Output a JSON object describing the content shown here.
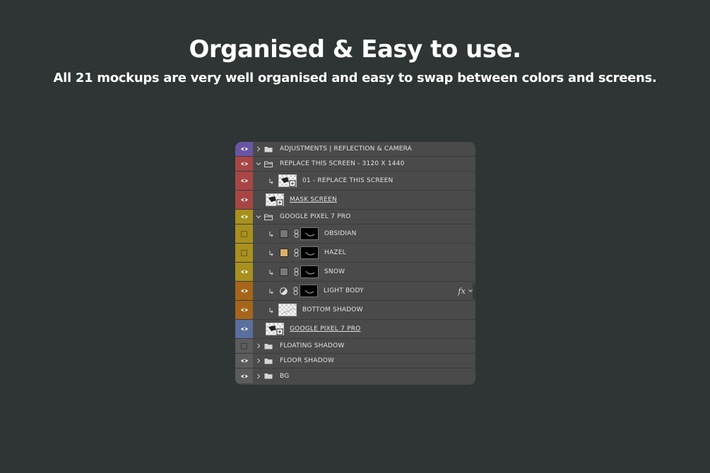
{
  "header": {
    "title": "Organised & Easy to use.",
    "subtitle": "All 21 mockups are very well organised and easy to swap between colors and screens."
  },
  "colors": {
    "background": "#2e3534",
    "panel": "#4a4a4a",
    "violet": "#6a55a5",
    "red": "#a84646",
    "yellow": "#a8901f",
    "orange": "#a5661b",
    "blue": "#5a6f9d",
    "gray": "#5c5c5c"
  },
  "layers": [
    {
      "name": "ADJUSTMENTS | REFLECTION & CAMERA",
      "kind": "group-closed",
      "visible": true,
      "color": "violet"
    },
    {
      "name": "REPLACE THIS SCREEN - 3120 X 1440",
      "kind": "group-open",
      "visible": true,
      "color": "red"
    },
    {
      "name": "01 - REPLACE THIS SCREEN",
      "kind": "smart-object",
      "clipped": true,
      "visible": true,
      "color": "red"
    },
    {
      "name": "MASK SCREEN",
      "kind": "smart-object-base",
      "visible": true,
      "color": "red"
    },
    {
      "name": "GOOGLE PIXEL 7 PRO",
      "kind": "group-open",
      "visible": true,
      "color": "yellow"
    },
    {
      "name": "OBSIDIAN",
      "kind": "fill",
      "swatch": "#777777",
      "clipped": true,
      "visible": false,
      "color": "yellow"
    },
    {
      "name": "HAZEL",
      "kind": "fill",
      "swatch": "#d9b06a",
      "clipped": true,
      "visible": false,
      "color": "yellow"
    },
    {
      "name": "SNOW",
      "kind": "fill",
      "swatch": "#7a7a7a",
      "clipped": true,
      "visible": true,
      "color": "yellow"
    },
    {
      "name": "LIGHT BODY",
      "kind": "adjustment",
      "clipped": true,
      "visible": true,
      "color": "orange",
      "effects": "fx"
    },
    {
      "name": "BOTTOM SHADOW",
      "kind": "pixel",
      "clipped": true,
      "visible": true,
      "color": "orange"
    },
    {
      "name": "GOOGLE PIXEL 7 PRO",
      "kind": "smart-object-base",
      "visible": true,
      "color": "blue"
    },
    {
      "name": "FLOATING SHADOW",
      "kind": "group-closed",
      "visible": false,
      "color": "gray"
    },
    {
      "name": "FLOOR SHADOW",
      "kind": "group-closed",
      "visible": true,
      "color": "gray"
    },
    {
      "name": "BG",
      "kind": "group-closed",
      "visible": true,
      "color": "gray"
    }
  ]
}
